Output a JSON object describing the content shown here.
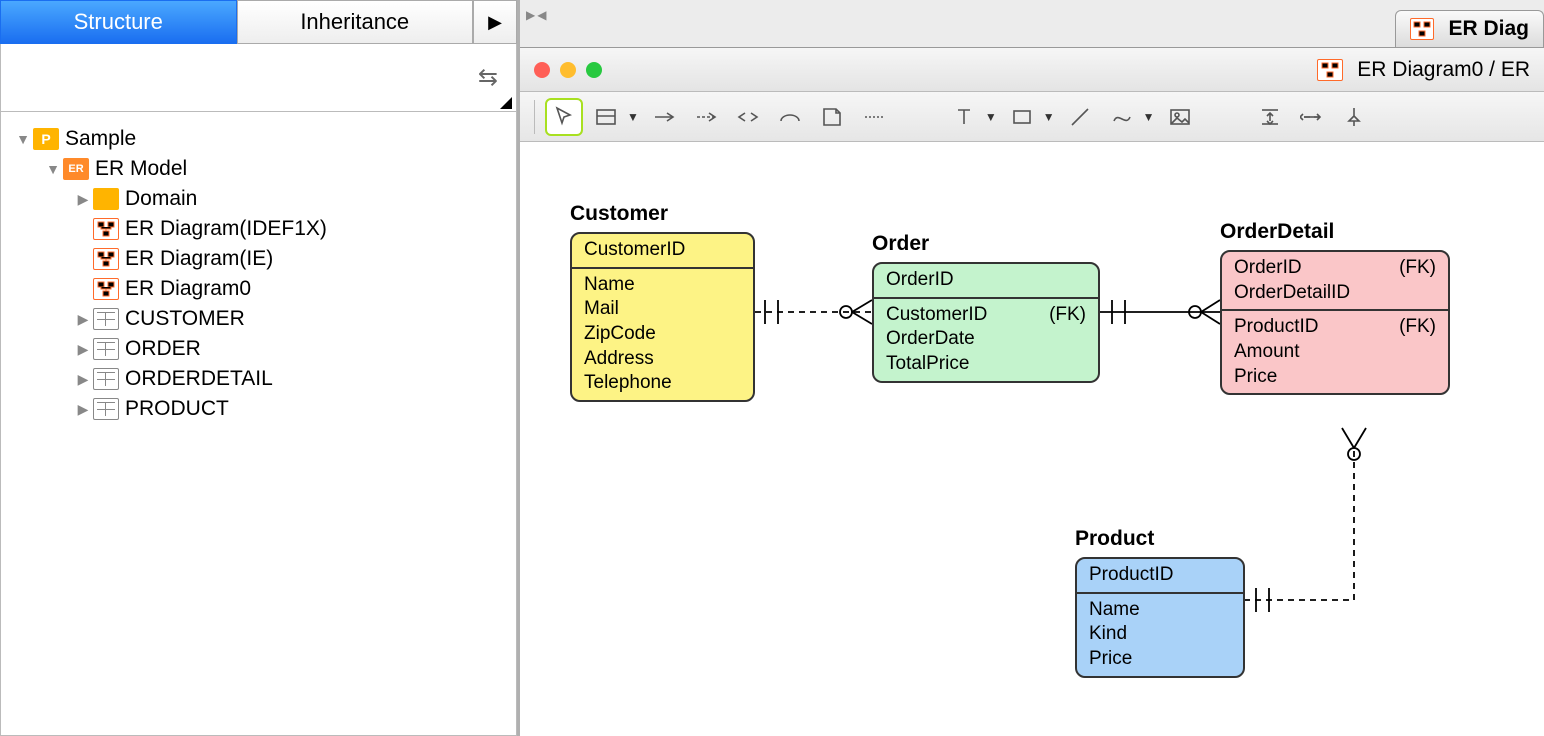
{
  "tabs": {
    "structure": "Structure",
    "inheritance": "Inheritance"
  },
  "tree": {
    "root": "Sample",
    "model": "ER Model",
    "domain": "Domain",
    "diagrams": [
      "ER Diagram(IDEF1X)",
      "ER Diagram(IE)",
      "ER Diagram0"
    ],
    "tables": [
      "CUSTOMER",
      "ORDER",
      "ORDERDETAIL",
      "PRODUCT"
    ]
  },
  "topTab": "ER Diag",
  "windowTitle": "ER Diagram0 / ER",
  "entities": {
    "customer": {
      "name": "Customer",
      "pk": [
        "CustomerID"
      ],
      "attrs": [
        "Name",
        "Mail",
        "ZipCode",
        "Address",
        "Telephone"
      ]
    },
    "order": {
      "name": "Order",
      "pk": [
        "OrderID"
      ],
      "attrs": [
        {
          "n": "CustomerID",
          "fk": "(FK)"
        },
        {
          "n": "OrderDate"
        },
        {
          "n": "TotalPrice"
        }
      ]
    },
    "orderdetail": {
      "name": "OrderDetail",
      "pk": [
        {
          "n": "OrderID",
          "fk": "(FK)"
        },
        {
          "n": "OrderDetailID"
        }
      ],
      "attrs": [
        {
          "n": "ProductID",
          "fk": "(FK)"
        },
        {
          "n": "Amount"
        },
        {
          "n": "Price"
        }
      ]
    },
    "product": {
      "name": "Product",
      "pk": [
        "ProductID"
      ],
      "attrs": [
        "Name",
        "Kind",
        "Price"
      ]
    }
  },
  "fkLabel": "(FK)"
}
